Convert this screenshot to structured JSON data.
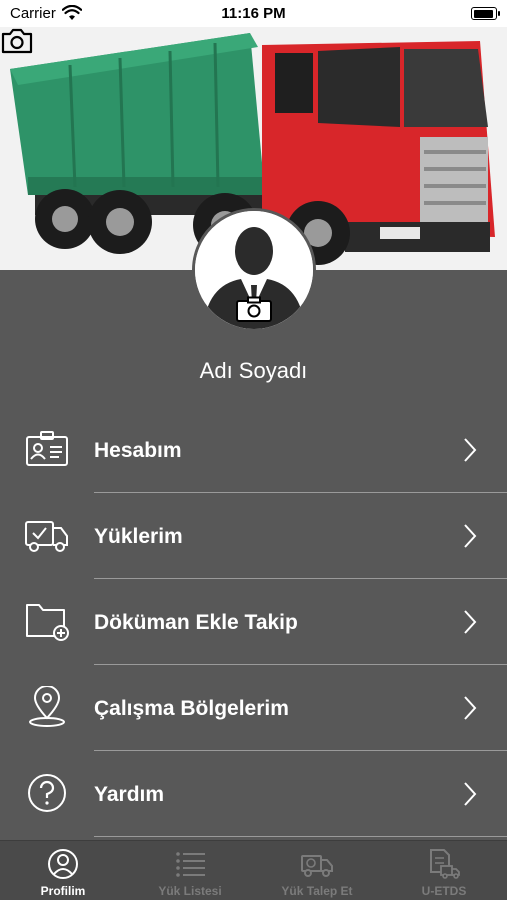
{
  "status_bar": {
    "carrier": "Carrier",
    "time": "11:16 PM"
  },
  "profile": {
    "name": "Adı Soyadı"
  },
  "menu": [
    {
      "label": "Hesabım",
      "icon": "id-card-icon"
    },
    {
      "label": "Yüklerim",
      "icon": "truck-check-icon"
    },
    {
      "label": "Döküman Ekle Takip",
      "icon": "folder-add-icon"
    },
    {
      "label": "Çalışma Bölgelerim",
      "icon": "location-pin-icon"
    },
    {
      "label": "Yardım",
      "icon": "help-icon"
    }
  ],
  "tabs": [
    {
      "label": "Profilim",
      "active": true,
      "icon": "user-circle-icon"
    },
    {
      "label": "Yük Listesi",
      "active": false,
      "icon": "list-icon"
    },
    {
      "label": "Yük Talep Et",
      "active": false,
      "icon": "truck-request-icon"
    },
    {
      "label": "U-ETDS",
      "active": false,
      "icon": "document-truck-icon"
    }
  ],
  "colors": {
    "background": "#585858",
    "tab_bar": "#4a4a4a",
    "active_tab": "#ffffff",
    "inactive_tab": "#7b7b7b",
    "separator": "#9a9a9a"
  }
}
